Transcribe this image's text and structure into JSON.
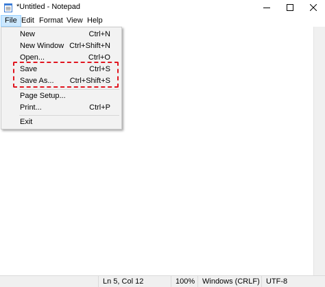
{
  "window": {
    "title": "*Untitled - Notepad",
    "icon": "notepad-icon"
  },
  "menubar": {
    "items": [
      {
        "label": "File"
      },
      {
        "label": "Edit"
      },
      {
        "label": "Format"
      },
      {
        "label": "View"
      },
      {
        "label": "Help"
      }
    ]
  },
  "file_menu": {
    "items": [
      {
        "label": "New",
        "shortcut": "Ctrl+N"
      },
      {
        "label": "New Window",
        "shortcut": "Ctrl+Shift+N"
      },
      {
        "label": "Open...",
        "shortcut": "Ctrl+O"
      },
      {
        "label": "Save",
        "shortcut": "Ctrl+S"
      },
      {
        "label": "Save As...",
        "shortcut": "Ctrl+Shift+S"
      },
      {
        "label": "Page Setup...",
        "shortcut": ""
      },
      {
        "label": "Print...",
        "shortcut": "Ctrl+P"
      },
      {
        "label": "Exit",
        "shortcut": ""
      }
    ]
  },
  "statusbar": {
    "position": "Ln 5, Col 12",
    "zoom": "100%",
    "line_ending": "Windows (CRLF)",
    "encoding": "UTF-8"
  },
  "colors": {
    "highlight_border": "#e0141e",
    "menu_active_bg": "#cce8ff"
  }
}
